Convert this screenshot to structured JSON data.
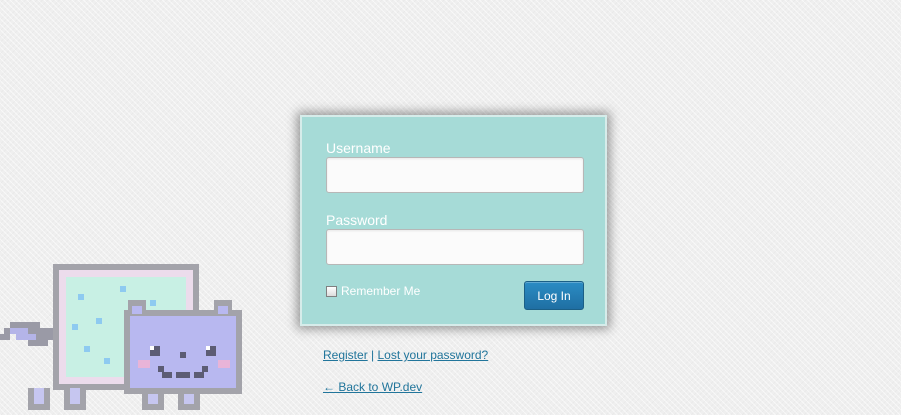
{
  "login_form": {
    "username_label": "Username",
    "username_value": "",
    "password_label": "Password",
    "password_value": "",
    "remember_label": "Remember Me",
    "remember_checked": false,
    "submit_label": "Log In"
  },
  "nav": {
    "register_label": "Register",
    "separator": "|",
    "lost_password_label": "Lost your password?",
    "back_label": "← Back to WP.dev"
  },
  "theme": {
    "card_color": "#a6dbd7",
    "button_color": "#2179b0",
    "link_color": "#21759b",
    "background_color": "#efefef"
  },
  "mascot": {
    "icon": "nyan-cat-icon"
  }
}
